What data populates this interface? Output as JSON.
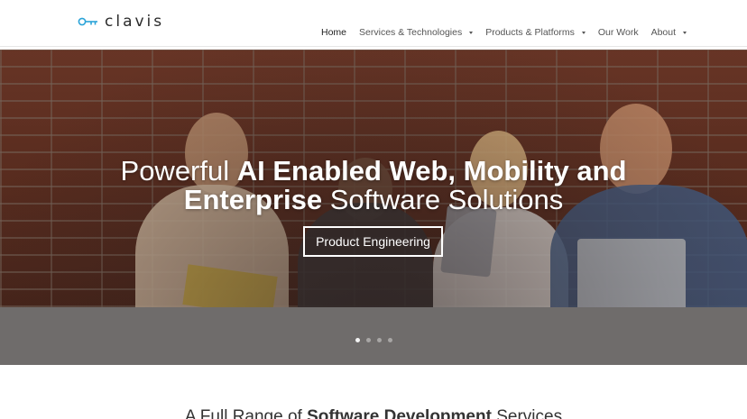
{
  "brand": {
    "name": "clavis",
    "logo_icon": "key-icon",
    "accent": "#2aa3d8"
  },
  "nav": {
    "items": [
      {
        "label": "Home",
        "active": true,
        "dropdown": false
      },
      {
        "label": "Services & Technologies",
        "active": false,
        "dropdown": true
      },
      {
        "label": "Products & Platforms",
        "active": false,
        "dropdown": true
      },
      {
        "label": "Our Work",
        "active": false,
        "dropdown": false
      },
      {
        "label": "About",
        "active": false,
        "dropdown": true
      }
    ]
  },
  "hero": {
    "line1_light": "Powerful ",
    "line1_bold": "AI Enabled Web, Mobility and",
    "line2_bold": "Enterprise",
    "line2_light": " Software Solutions",
    "cta_label": "Product Engineering"
  },
  "slider": {
    "slide_count": 4,
    "active_index": 0
  },
  "section": {
    "title_light1": "A Full Range of ",
    "title_bold": "Software Development",
    "title_light2": " Services"
  }
}
